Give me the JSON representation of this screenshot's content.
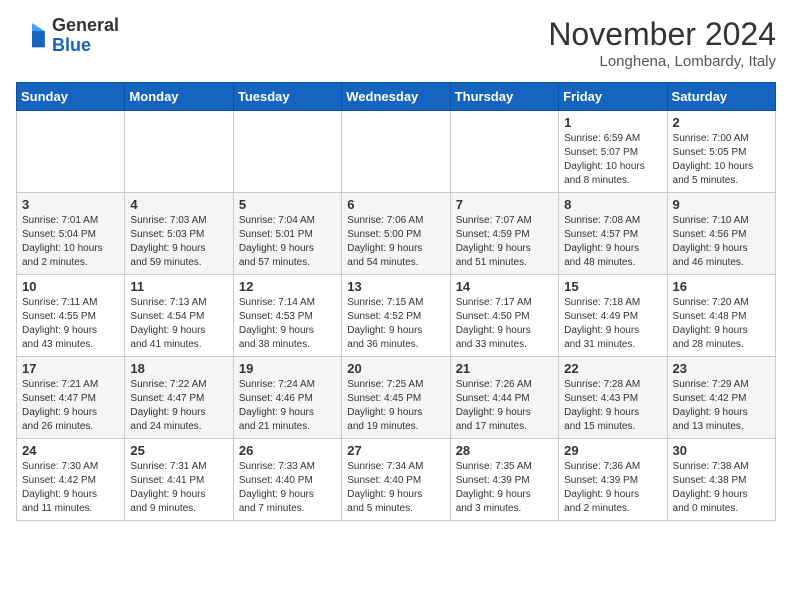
{
  "header": {
    "logo_general": "General",
    "logo_blue": "Blue",
    "month_title": "November 2024",
    "location": "Longhena, Lombardy, Italy"
  },
  "days_of_week": [
    "Sunday",
    "Monday",
    "Tuesday",
    "Wednesday",
    "Thursday",
    "Friday",
    "Saturday"
  ],
  "weeks": [
    [
      {
        "day": "",
        "info": ""
      },
      {
        "day": "",
        "info": ""
      },
      {
        "day": "",
        "info": ""
      },
      {
        "day": "",
        "info": ""
      },
      {
        "day": "",
        "info": ""
      },
      {
        "day": "1",
        "info": "Sunrise: 6:59 AM\nSunset: 5:07 PM\nDaylight: 10 hours\nand 8 minutes."
      },
      {
        "day": "2",
        "info": "Sunrise: 7:00 AM\nSunset: 5:05 PM\nDaylight: 10 hours\nand 5 minutes."
      }
    ],
    [
      {
        "day": "3",
        "info": "Sunrise: 7:01 AM\nSunset: 5:04 PM\nDaylight: 10 hours\nand 2 minutes."
      },
      {
        "day": "4",
        "info": "Sunrise: 7:03 AM\nSunset: 5:03 PM\nDaylight: 9 hours\nand 59 minutes."
      },
      {
        "day": "5",
        "info": "Sunrise: 7:04 AM\nSunset: 5:01 PM\nDaylight: 9 hours\nand 57 minutes."
      },
      {
        "day": "6",
        "info": "Sunrise: 7:06 AM\nSunset: 5:00 PM\nDaylight: 9 hours\nand 54 minutes."
      },
      {
        "day": "7",
        "info": "Sunrise: 7:07 AM\nSunset: 4:59 PM\nDaylight: 9 hours\nand 51 minutes."
      },
      {
        "day": "8",
        "info": "Sunrise: 7:08 AM\nSunset: 4:57 PM\nDaylight: 9 hours\nand 48 minutes."
      },
      {
        "day": "9",
        "info": "Sunrise: 7:10 AM\nSunset: 4:56 PM\nDaylight: 9 hours\nand 46 minutes."
      }
    ],
    [
      {
        "day": "10",
        "info": "Sunrise: 7:11 AM\nSunset: 4:55 PM\nDaylight: 9 hours\nand 43 minutes."
      },
      {
        "day": "11",
        "info": "Sunrise: 7:13 AM\nSunset: 4:54 PM\nDaylight: 9 hours\nand 41 minutes."
      },
      {
        "day": "12",
        "info": "Sunrise: 7:14 AM\nSunset: 4:53 PM\nDaylight: 9 hours\nand 38 minutes."
      },
      {
        "day": "13",
        "info": "Sunrise: 7:15 AM\nSunset: 4:52 PM\nDaylight: 9 hours\nand 36 minutes."
      },
      {
        "day": "14",
        "info": "Sunrise: 7:17 AM\nSunset: 4:50 PM\nDaylight: 9 hours\nand 33 minutes."
      },
      {
        "day": "15",
        "info": "Sunrise: 7:18 AM\nSunset: 4:49 PM\nDaylight: 9 hours\nand 31 minutes."
      },
      {
        "day": "16",
        "info": "Sunrise: 7:20 AM\nSunset: 4:48 PM\nDaylight: 9 hours\nand 28 minutes."
      }
    ],
    [
      {
        "day": "17",
        "info": "Sunrise: 7:21 AM\nSunset: 4:47 PM\nDaylight: 9 hours\nand 26 minutes."
      },
      {
        "day": "18",
        "info": "Sunrise: 7:22 AM\nSunset: 4:47 PM\nDaylight: 9 hours\nand 24 minutes."
      },
      {
        "day": "19",
        "info": "Sunrise: 7:24 AM\nSunset: 4:46 PM\nDaylight: 9 hours\nand 21 minutes."
      },
      {
        "day": "20",
        "info": "Sunrise: 7:25 AM\nSunset: 4:45 PM\nDaylight: 9 hours\nand 19 minutes."
      },
      {
        "day": "21",
        "info": "Sunrise: 7:26 AM\nSunset: 4:44 PM\nDaylight: 9 hours\nand 17 minutes."
      },
      {
        "day": "22",
        "info": "Sunrise: 7:28 AM\nSunset: 4:43 PM\nDaylight: 9 hours\nand 15 minutes."
      },
      {
        "day": "23",
        "info": "Sunrise: 7:29 AM\nSunset: 4:42 PM\nDaylight: 9 hours\nand 13 minutes."
      }
    ],
    [
      {
        "day": "24",
        "info": "Sunrise: 7:30 AM\nSunset: 4:42 PM\nDaylight: 9 hours\nand 11 minutes."
      },
      {
        "day": "25",
        "info": "Sunrise: 7:31 AM\nSunset: 4:41 PM\nDaylight: 9 hours\nand 9 minutes."
      },
      {
        "day": "26",
        "info": "Sunrise: 7:33 AM\nSunset: 4:40 PM\nDaylight: 9 hours\nand 7 minutes."
      },
      {
        "day": "27",
        "info": "Sunrise: 7:34 AM\nSunset: 4:40 PM\nDaylight: 9 hours\nand 5 minutes."
      },
      {
        "day": "28",
        "info": "Sunrise: 7:35 AM\nSunset: 4:39 PM\nDaylight: 9 hours\nand 3 minutes."
      },
      {
        "day": "29",
        "info": "Sunrise: 7:36 AM\nSunset: 4:39 PM\nDaylight: 9 hours\nand 2 minutes."
      },
      {
        "day": "30",
        "info": "Sunrise: 7:38 AM\nSunset: 4:38 PM\nDaylight: 9 hours\nand 0 minutes."
      }
    ]
  ]
}
